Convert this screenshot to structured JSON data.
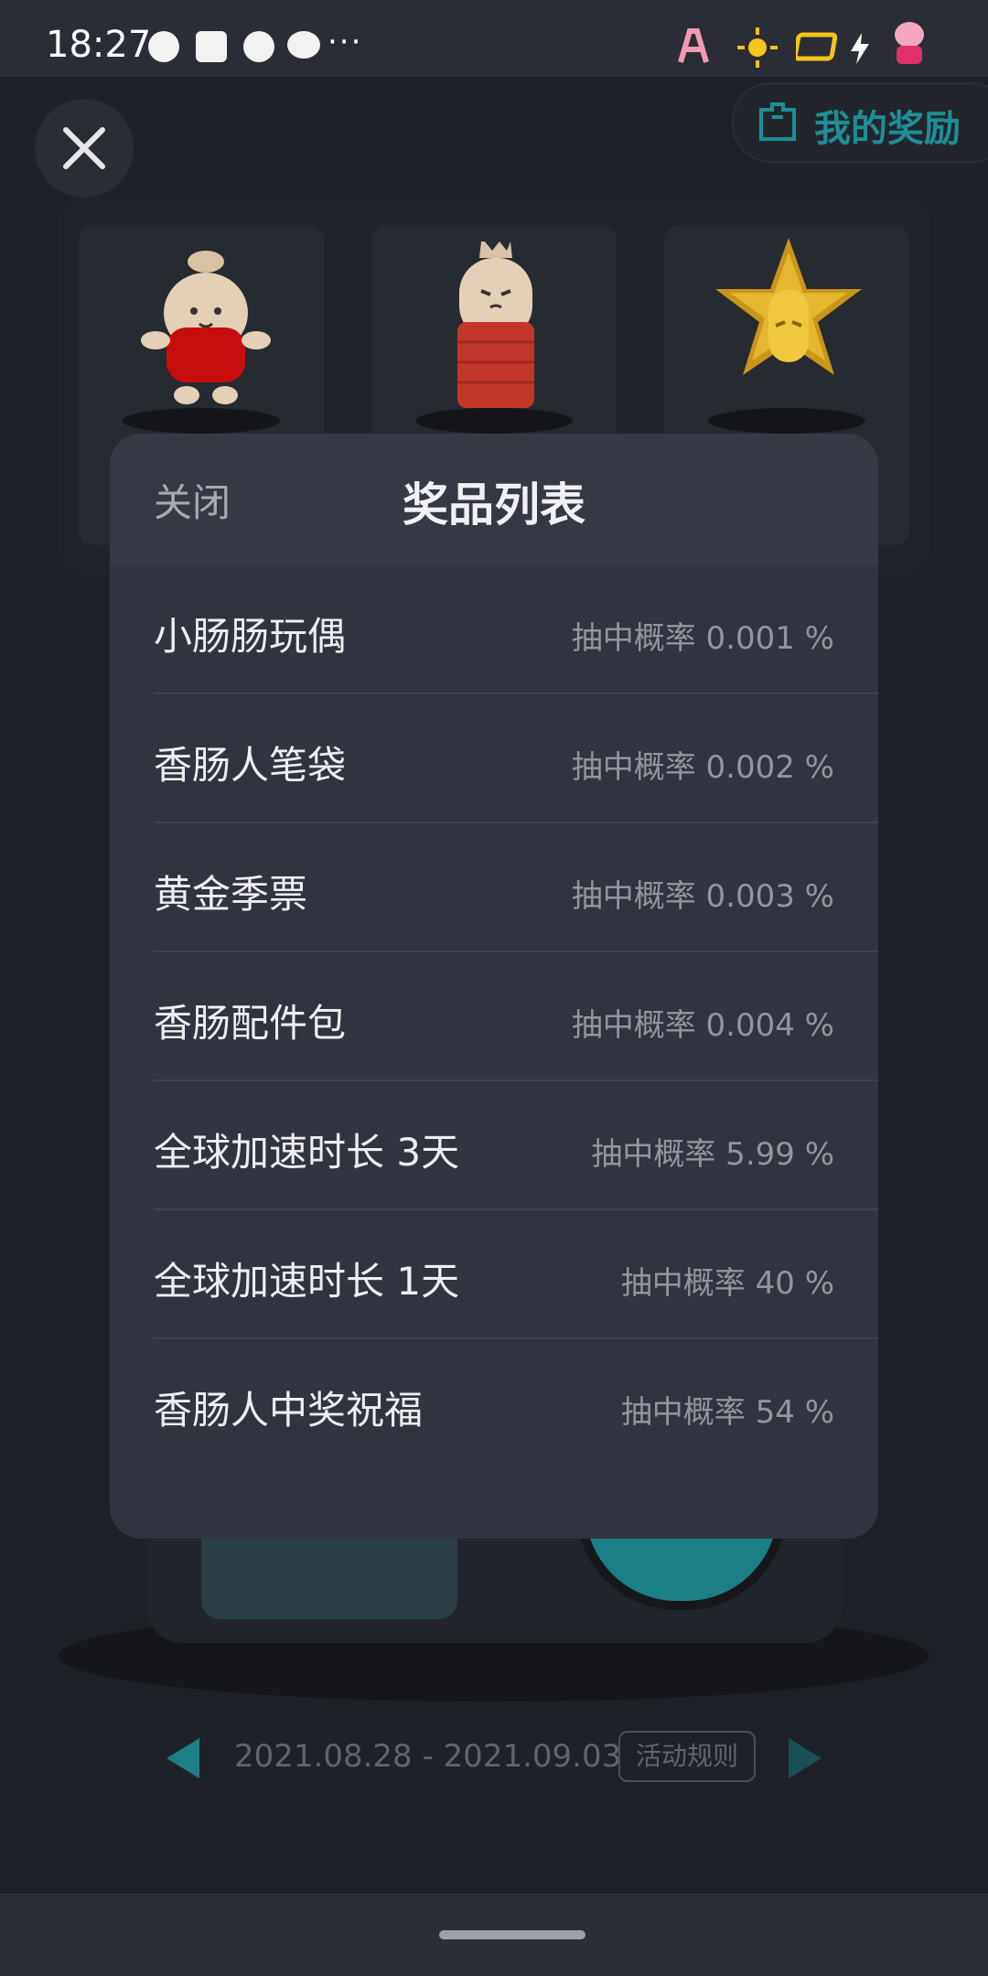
{
  "status_bar": {
    "time": "18:27",
    "more": "···"
  },
  "background_page": {
    "my_rewards_label": "我的奖励",
    "date_range": "2021.08.28 - 2021.09.03",
    "rules_label": "活动规则"
  },
  "modal": {
    "close_label": "关闭",
    "title": "奖品列表",
    "items": [
      {
        "name": "小肠肠玩偶",
        "probability": "抽中概率 0.001 %"
      },
      {
        "name": "香肠人笔袋",
        "probability": "抽中概率 0.002 %"
      },
      {
        "name": "黄金季票",
        "probability": "抽中概率 0.003 %"
      },
      {
        "name": "香肠配件包",
        "probability": "抽中概率 0.004 %"
      },
      {
        "name": "全球加速时长 3天",
        "probability": "抽中概率 5.99 %"
      },
      {
        "name": "全球加速时长 1天",
        "probability": "抽中概率 40 %"
      },
      {
        "name": "香肠人中奖祝福",
        "probability": "抽中概率 54 %"
      }
    ]
  },
  "colors": {
    "accent_teal": "#1e8f94",
    "modal_bg": "#31343e",
    "background": "#1b1d23"
  }
}
